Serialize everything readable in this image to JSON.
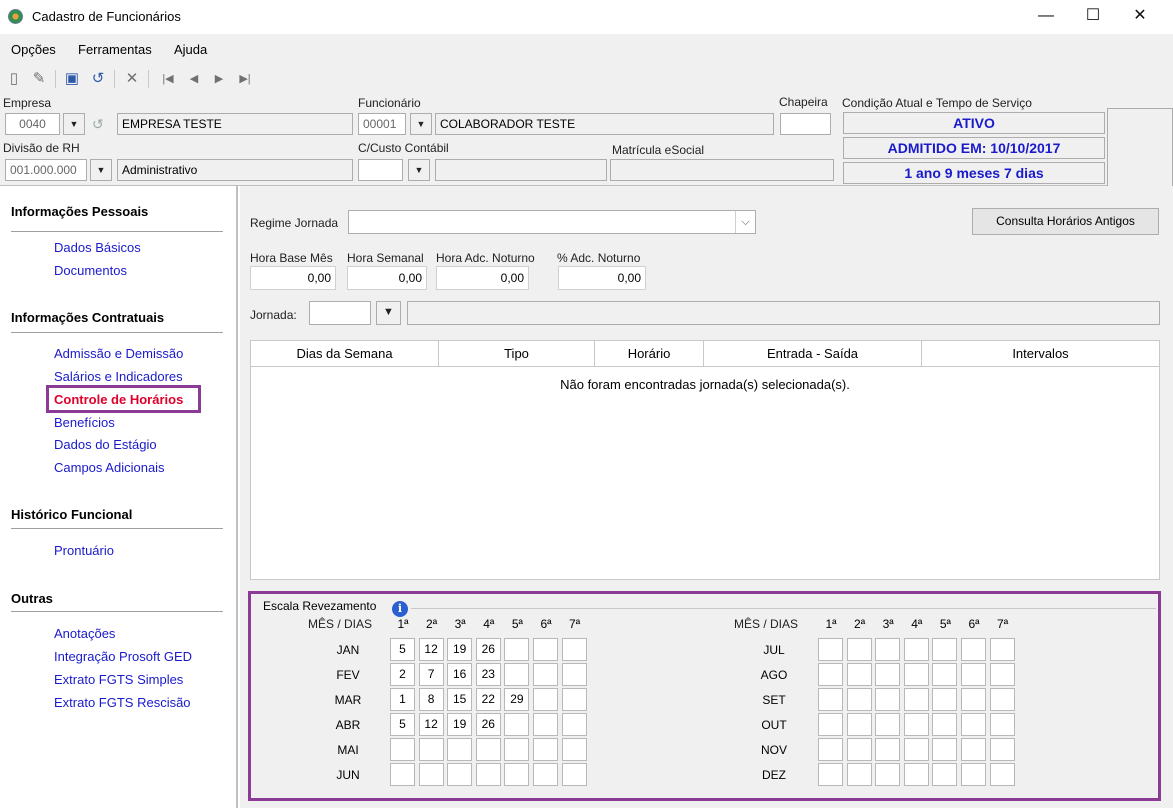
{
  "window": {
    "title": "Cadastro de Funcionários",
    "minimize": "—",
    "maximize": "☐",
    "close": "✕"
  },
  "menu": [
    {
      "label": "Opções"
    },
    {
      "label": "Ferramentas"
    },
    {
      "label": "Ajuda"
    }
  ],
  "toolbar": {
    "icons": [
      "new-icon",
      "edit-icon",
      "save-icon",
      "undo-icon",
      "delete-icon",
      "first-icon",
      "prev-icon",
      "next-icon",
      "last-icon"
    ]
  },
  "header": {
    "empresa": {
      "label": "Empresa",
      "code": "0040",
      "name": "EMPRESA TESTE"
    },
    "funcionario": {
      "label": "Funcionário",
      "code": "00001",
      "name": "COLABORADOR TESTE"
    },
    "chapeira": {
      "label": "Chapeira",
      "value": ""
    },
    "condicao": {
      "label": "Condição Atual e Tempo de Serviço",
      "status": "ATIVO",
      "admitido": "ADMITIDO EM: 10/10/2017",
      "tempo": "1 ano 9 meses 7 dias"
    },
    "divisao": {
      "label": "Divisão de RH",
      "code": "001.000.000",
      "name": "Administrativo"
    },
    "custo": {
      "label": "C/Custo Contábil",
      "code": "",
      "name": ""
    },
    "matricula": {
      "label": "Matrícula eSocial",
      "value": ""
    }
  },
  "sidebar": {
    "sections": [
      {
        "title": "Informações Pessoais",
        "items": [
          "Dados Básicos",
          "Documentos"
        ]
      },
      {
        "title": "Informações Contratuais",
        "items": [
          "Admissão e Demissão",
          "Salários e Indicadores",
          "Controle de Horários",
          "Benefícios",
          "Dados do Estágio",
          "Campos Adicionais"
        ]
      },
      {
        "title": "Histórico Funcional",
        "items": [
          "Prontuário"
        ]
      },
      {
        "title": "Outras",
        "items": [
          "Anotações",
          "Integração Prosoft GED",
          "Extrato FGTS Simples",
          "Extrato FGTS Rescisão"
        ]
      }
    ],
    "active_item": "Controle de Horários"
  },
  "main": {
    "regime_label": "Regime Jornada",
    "regime_value": "",
    "consulta_button": "Consulta Horários Antigos",
    "hora_base": {
      "label": "Hora Base Mês",
      "value": "0,00"
    },
    "hora_semanal": {
      "label": "Hora Semanal",
      "value": "0,00"
    },
    "hora_adc": {
      "label": "Hora Adc. Noturno",
      "value": "0,00"
    },
    "pct_adc": {
      "label": "% Adc. Noturno",
      "value": "0,00"
    },
    "jornada_label": "Jornada:",
    "grid": {
      "columns": [
        "Dias da Semana",
        "Tipo",
        "Horário",
        "Entrada - Saída",
        "Intervalos"
      ],
      "empty_message": "Não foram encontradas jornada(s) selecionada(s)."
    }
  },
  "escala": {
    "legend": "Escala Revezamento",
    "mes_dias": "MÊS / DIAS",
    "day_headers": [
      "1ª",
      "2ª",
      "3ª",
      "4ª",
      "5ª",
      "6ª",
      "7ª"
    ],
    "left": [
      {
        "month": "JAN",
        "days": [
          "5",
          "12",
          "19",
          "26",
          "",
          "",
          ""
        ]
      },
      {
        "month": "FEV",
        "days": [
          "2",
          "7",
          "16",
          "23",
          "",
          "",
          ""
        ]
      },
      {
        "month": "MAR",
        "days": [
          "1",
          "8",
          "15",
          "22",
          "29",
          "",
          ""
        ]
      },
      {
        "month": "ABR",
        "days": [
          "5",
          "12",
          "19",
          "26",
          "",
          "",
          ""
        ]
      },
      {
        "month": "MAI",
        "days": [
          "",
          "",
          "",
          "",
          "",
          "",
          ""
        ]
      },
      {
        "month": "JUN",
        "days": [
          "",
          "",
          "",
          "",
          "",
          "",
          ""
        ]
      }
    ],
    "right": [
      {
        "month": "JUL",
        "days": [
          "",
          "",
          "",
          "",
          "",
          "",
          ""
        ]
      },
      {
        "month": "AGO",
        "days": [
          "",
          "",
          "",
          "",
          "",
          "",
          ""
        ]
      },
      {
        "month": "SET",
        "days": [
          "",
          "",
          "",
          "",
          "",
          "",
          ""
        ]
      },
      {
        "month": "OUT",
        "days": [
          "",
          "",
          "",
          "",
          "",
          "",
          ""
        ]
      },
      {
        "month": "NOV",
        "days": [
          "",
          "",
          "",
          "",
          "",
          "",
          ""
        ]
      },
      {
        "month": "DEZ",
        "days": [
          "",
          "",
          "",
          "",
          "",
          "",
          ""
        ]
      }
    ]
  },
  "colors": {
    "link": "#1a1acc",
    "active": "#e0002a",
    "highlight": "#8b3a96",
    "status": "#1a1acc"
  }
}
